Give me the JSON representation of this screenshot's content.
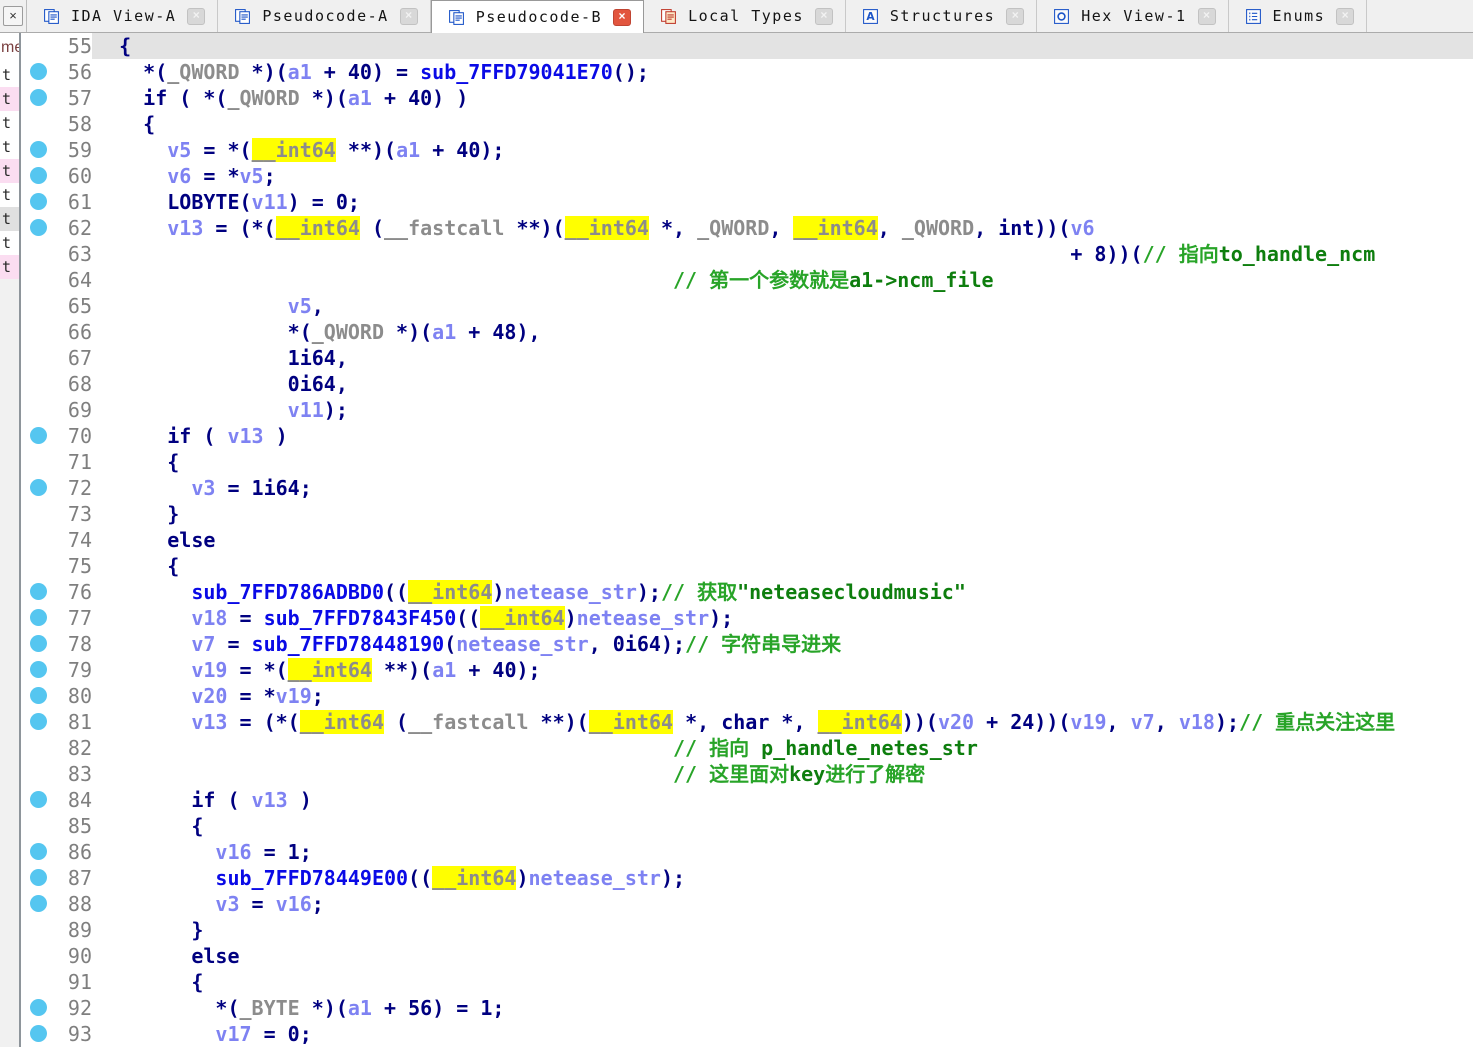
{
  "window": {
    "close_label": "×"
  },
  "tabs": [
    {
      "label": "IDA View-A",
      "icon": "ida-view",
      "active": false
    },
    {
      "label": "Pseudocode-A",
      "icon": "pseudocode",
      "active": false
    },
    {
      "label": "Pseudocode-B",
      "icon": "pseudocode",
      "active": true
    },
    {
      "label": "Local Types",
      "icon": "local-types",
      "active": false
    },
    {
      "label": "Structures",
      "icon": "structures",
      "active": false
    },
    {
      "label": "Hex View-1",
      "icon": "hex-view",
      "active": false
    },
    {
      "label": "Enums",
      "icon": "enums",
      "active": false
    }
  ],
  "side_panel": {
    "header_fragment": "me",
    "rows": [
      {
        "text": "t",
        "bg": "plain"
      },
      {
        "text": "t",
        "bg": "pink"
      },
      {
        "text": "t",
        "bg": "plain"
      },
      {
        "text": "t",
        "bg": "plain"
      },
      {
        "text": "t",
        "bg": "pink"
      },
      {
        "text": "t",
        "bg": "plain"
      },
      {
        "text": "t",
        "bg": "gray"
      },
      {
        "text": "t",
        "bg": "plain"
      },
      {
        "text": "t",
        "bg": "pink"
      }
    ]
  },
  "colors": {
    "highlight": "#FFFF00",
    "dot": "#55C6F0",
    "current_line": "#E3E3E3",
    "keyword": "#000080",
    "variable": "#7E82F2",
    "type": "#8C8C8C",
    "function": "#0A0AE6",
    "comment": "#28A428",
    "comment_emphasis": "#0E7E0E",
    "line_number": "#7F7F7F",
    "active_tab_close": "#E2553E"
  },
  "code": {
    "first_line": 55,
    "current_line": 55,
    "breakpoint_lines": [
      56,
      57,
      59,
      60,
      61,
      62,
      70,
      72,
      76,
      77,
      78,
      79,
      80,
      81,
      84,
      86,
      87,
      88,
      92,
      93
    ],
    "lines": [
      {
        "n": 55,
        "parts": [
          [
            "k",
            "  {"
          ]
        ]
      },
      {
        "n": 56,
        "parts": [
          [
            "k",
            "    *("
          ],
          [
            "t",
            "_QWORD"
          ],
          [
            "k",
            " *)("
          ],
          [
            "v",
            "a1"
          ],
          [
            "k",
            " + 40) = "
          ],
          [
            "f",
            "sub_7FFD79041E70"
          ],
          [
            "k",
            "();"
          ]
        ]
      },
      {
        "n": 57,
        "parts": [
          [
            "k",
            "    if ( *("
          ],
          [
            "t",
            "_QWORD"
          ],
          [
            "k",
            " *)("
          ],
          [
            "v",
            "a1"
          ],
          [
            "k",
            " + 40) )"
          ]
        ]
      },
      {
        "n": 58,
        "parts": [
          [
            "k",
            "    {"
          ]
        ]
      },
      {
        "n": 59,
        "parts": [
          [
            "k",
            "      "
          ],
          [
            "v",
            "v5"
          ],
          [
            "k",
            " = *("
          ],
          [
            "h",
            "__int64"
          ],
          [
            "k",
            " **)("
          ],
          [
            "v",
            "a1"
          ],
          [
            "k",
            " + 40);"
          ]
        ]
      },
      {
        "n": 60,
        "parts": [
          [
            "k",
            "      "
          ],
          [
            "v",
            "v6"
          ],
          [
            "k",
            " = *"
          ],
          [
            "v",
            "v5"
          ],
          [
            "k",
            ";"
          ]
        ]
      },
      {
        "n": 61,
        "parts": [
          [
            "k",
            "      LOBYTE("
          ],
          [
            "v",
            "v11"
          ],
          [
            "k",
            ") = 0;"
          ]
        ]
      },
      {
        "n": 62,
        "parts": [
          [
            "k",
            "      "
          ],
          [
            "v",
            "v13"
          ],
          [
            "k",
            " = (*("
          ],
          [
            "h",
            "__int64"
          ],
          [
            "k",
            " ("
          ],
          [
            "t",
            "__fastcall"
          ],
          [
            "k",
            " **)("
          ],
          [
            "h",
            "__int64"
          ],
          [
            "k",
            " *, "
          ],
          [
            "t",
            "_QWORD"
          ],
          [
            "k",
            ", "
          ],
          [
            "h",
            "__int64"
          ],
          [
            "k",
            ", "
          ],
          [
            "t",
            "_QWORD"
          ],
          [
            "k",
            ", int))("
          ],
          [
            "v",
            "v6"
          ]
        ]
      },
      {
        "n": 63,
        "parts": [
          [
            "sp",
            81
          ],
          [
            "k",
            "+ 8))("
          ],
          [
            "c",
            "// 指向"
          ],
          [
            "cb",
            "to_handle_ncm"
          ]
        ]
      },
      {
        "n": 64,
        "parts": [
          [
            "sp",
            48
          ],
          [
            "c",
            "// 第一个参数就是"
          ],
          [
            "cb",
            "a1->ncm_file"
          ]
        ]
      },
      {
        "n": 65,
        "parts": [
          [
            "sp",
            16
          ],
          [
            "v",
            "v5"
          ],
          [
            "k",
            ","
          ]
        ]
      },
      {
        "n": 66,
        "parts": [
          [
            "sp",
            16
          ],
          [
            "k",
            "*("
          ],
          [
            "t",
            "_QWORD"
          ],
          [
            "k",
            " *)("
          ],
          [
            "v",
            "a1"
          ],
          [
            "k",
            " + 48),"
          ]
        ]
      },
      {
        "n": 67,
        "parts": [
          [
            "sp",
            16
          ],
          [
            "k",
            "1i64,"
          ]
        ]
      },
      {
        "n": 68,
        "parts": [
          [
            "sp",
            16
          ],
          [
            "k",
            "0i64,"
          ]
        ]
      },
      {
        "n": 69,
        "parts": [
          [
            "sp",
            16
          ],
          [
            "v",
            "v11"
          ],
          [
            "k",
            ");"
          ]
        ]
      },
      {
        "n": 70,
        "parts": [
          [
            "k",
            "      if ( "
          ],
          [
            "v",
            "v13"
          ],
          [
            "k",
            " )"
          ]
        ]
      },
      {
        "n": 71,
        "parts": [
          [
            "k",
            "      {"
          ]
        ]
      },
      {
        "n": 72,
        "parts": [
          [
            "k",
            "        "
          ],
          [
            "v",
            "v3"
          ],
          [
            "k",
            " = 1i64;"
          ]
        ]
      },
      {
        "n": 73,
        "parts": [
          [
            "k",
            "      }"
          ]
        ]
      },
      {
        "n": 74,
        "parts": [
          [
            "k",
            "      else"
          ]
        ]
      },
      {
        "n": 75,
        "parts": [
          [
            "k",
            "      {"
          ]
        ]
      },
      {
        "n": 76,
        "parts": [
          [
            "k",
            "        "
          ],
          [
            "f",
            "sub_7FFD786ADBD0"
          ],
          [
            "k",
            "(("
          ],
          [
            "h",
            "__int64"
          ],
          [
            "k",
            ")"
          ],
          [
            "v",
            "netease_str"
          ],
          [
            "k",
            ");"
          ],
          [
            "c",
            "// 获取"
          ],
          [
            "cb",
            "\"neteasecloudmusic\""
          ]
        ]
      },
      {
        "n": 77,
        "parts": [
          [
            "k",
            "        "
          ],
          [
            "v",
            "v18"
          ],
          [
            "k",
            " = "
          ],
          [
            "f",
            "sub_7FFD7843F450"
          ],
          [
            "k",
            "(("
          ],
          [
            "h",
            "__int64"
          ],
          [
            "k",
            ")"
          ],
          [
            "v",
            "netease_str"
          ],
          [
            "k",
            ");"
          ]
        ]
      },
      {
        "n": 78,
        "parts": [
          [
            "k",
            "        "
          ],
          [
            "v",
            "v7"
          ],
          [
            "k",
            " = "
          ],
          [
            "f",
            "sub_7FFD78448190"
          ],
          [
            "k",
            "("
          ],
          [
            "v",
            "netease_str"
          ],
          [
            "k",
            ", 0i64);"
          ],
          [
            "c",
            "// 字符串导进来"
          ]
        ]
      },
      {
        "n": 79,
        "parts": [
          [
            "k",
            "        "
          ],
          [
            "v",
            "v19"
          ],
          [
            "k",
            " = *("
          ],
          [
            "h",
            "__int64"
          ],
          [
            "k",
            " **)("
          ],
          [
            "v",
            "a1"
          ],
          [
            "k",
            " + 40);"
          ]
        ]
      },
      {
        "n": 80,
        "parts": [
          [
            "k",
            "        "
          ],
          [
            "v",
            "v20"
          ],
          [
            "k",
            " = *"
          ],
          [
            "v",
            "v19"
          ],
          [
            "k",
            ";"
          ]
        ]
      },
      {
        "n": 81,
        "parts": [
          [
            "k",
            "        "
          ],
          [
            "v",
            "v13"
          ],
          [
            "k",
            " = (*("
          ],
          [
            "h",
            "__int64"
          ],
          [
            "k",
            " ("
          ],
          [
            "t",
            "__fastcall"
          ],
          [
            "k",
            " **)("
          ],
          [
            "h",
            "__int64"
          ],
          [
            "k",
            " *, char *, "
          ],
          [
            "h",
            "__int64"
          ],
          [
            "k",
            "))("
          ],
          [
            "v",
            "v20"
          ],
          [
            "k",
            " + 24))("
          ],
          [
            "v",
            "v19"
          ],
          [
            "k",
            ", "
          ],
          [
            "v",
            "v7"
          ],
          [
            "k",
            ", "
          ],
          [
            "v",
            "v18"
          ],
          [
            "k",
            ");"
          ],
          [
            "c",
            "// 重点关注这里"
          ]
        ]
      },
      {
        "n": 82,
        "parts": [
          [
            "sp",
            48
          ],
          [
            "c",
            "// 指向 "
          ],
          [
            "cb",
            "p_handle_netes_str"
          ]
        ]
      },
      {
        "n": 83,
        "parts": [
          [
            "sp",
            48
          ],
          [
            "c",
            "// 这里面对"
          ],
          [
            "cb",
            "key"
          ],
          [
            "c",
            "进行了解密"
          ]
        ]
      },
      {
        "n": 84,
        "parts": [
          [
            "k",
            "        if ( "
          ],
          [
            "v",
            "v13"
          ],
          [
            "k",
            " )"
          ]
        ]
      },
      {
        "n": 85,
        "parts": [
          [
            "k",
            "        {"
          ]
        ]
      },
      {
        "n": 86,
        "parts": [
          [
            "k",
            "          "
          ],
          [
            "v",
            "v16"
          ],
          [
            "k",
            " = 1;"
          ]
        ]
      },
      {
        "n": 87,
        "parts": [
          [
            "k",
            "          "
          ],
          [
            "f",
            "sub_7FFD78449E00"
          ],
          [
            "k",
            "(("
          ],
          [
            "h",
            "__int64"
          ],
          [
            "k",
            ")"
          ],
          [
            "v",
            "netease_str"
          ],
          [
            "k",
            ");"
          ]
        ]
      },
      {
        "n": 88,
        "parts": [
          [
            "k",
            "          "
          ],
          [
            "v",
            "v3"
          ],
          [
            "k",
            " = "
          ],
          [
            "v",
            "v16"
          ],
          [
            "k",
            ";"
          ]
        ]
      },
      {
        "n": 89,
        "parts": [
          [
            "k",
            "        }"
          ]
        ]
      },
      {
        "n": 90,
        "parts": [
          [
            "k",
            "        else"
          ]
        ]
      },
      {
        "n": 91,
        "parts": [
          [
            "k",
            "        {"
          ]
        ]
      },
      {
        "n": 92,
        "parts": [
          [
            "k",
            "          *("
          ],
          [
            "t",
            "_BYTE"
          ],
          [
            "k",
            " *)("
          ],
          [
            "v",
            "a1"
          ],
          [
            "k",
            " + 56) = 1;"
          ]
        ]
      },
      {
        "n": 93,
        "parts": [
          [
            "k",
            "          "
          ],
          [
            "v",
            "v17"
          ],
          [
            "k",
            " = 0;"
          ]
        ]
      }
    ]
  }
}
